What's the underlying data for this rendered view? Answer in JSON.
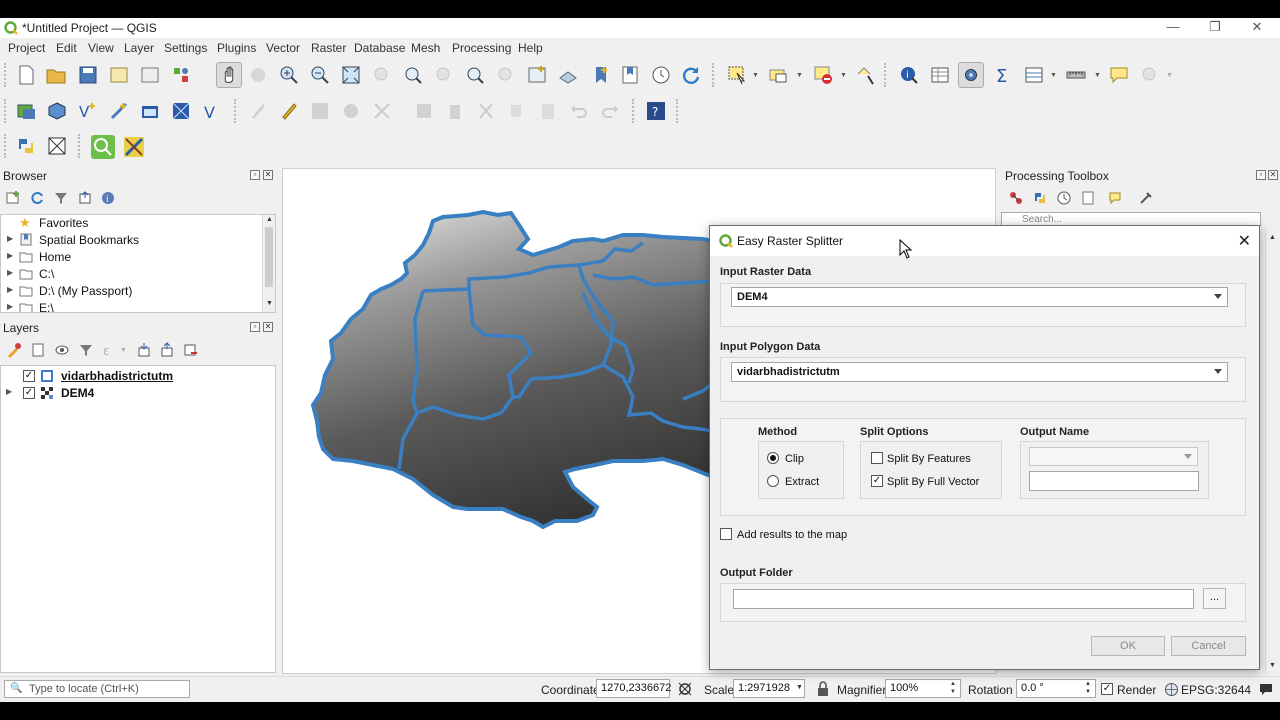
{
  "window": {
    "title": "*Untitled Project — QGIS",
    "controls": [
      "—",
      "❐",
      "✕"
    ]
  },
  "menubar": [
    "Project",
    "Edit",
    "View",
    "Layer",
    "Settings",
    "Plugins",
    "Vector",
    "Raster",
    "Database",
    "Mesh",
    "Processing",
    "Help"
  ],
  "browser": {
    "title": "Browser",
    "items": [
      {
        "label": "Favorites",
        "icon": "star-icon"
      },
      {
        "label": "Spatial Bookmarks",
        "icon": "bookmark-icon"
      },
      {
        "label": "Home",
        "icon": "folder-icon"
      },
      {
        "label": "C:\\",
        "icon": "folder-icon"
      },
      {
        "label": "D:\\ (My Passport)",
        "icon": "folder-icon"
      },
      {
        "label": "E:\\",
        "icon": "folder-icon"
      }
    ]
  },
  "layers": {
    "title": "Layers",
    "items": [
      {
        "label": "vidarbhadistrictutm",
        "checked": true
      },
      {
        "label": "DEM4",
        "checked": true
      }
    ]
  },
  "toolbox": {
    "title": "Processing Toolbox",
    "search_placeholder": "Search..."
  },
  "dialog": {
    "title": "Easy Raster Splitter",
    "input_raster_label": "Input Raster Data",
    "input_raster_value": "DEM4",
    "input_polygon_label": "Input Polygon Data",
    "input_polygon_value": "vidarbhadistrictutm",
    "method_label": "Method",
    "method_clip": "Clip",
    "method_extract": "Extract",
    "method_selected": "Clip",
    "split_options_label": "Split Options",
    "split_by_features": "Split By Features",
    "split_by_features_checked": false,
    "split_by_full_vector": "Split By Full Vector",
    "split_by_full_vector_checked": true,
    "output_name_label": "Output Name",
    "output_name_value": "",
    "add_results_label": "Add results to the map",
    "add_results_checked": false,
    "output_folder_label": "Output Folder",
    "output_folder_value": "",
    "browse_label": "...",
    "ok_label": "OK",
    "cancel_label": "Cancel"
  },
  "statusbar": {
    "locate_placeholder": "Type to locate (Ctrl+K)",
    "coordinate_label": "Coordinate",
    "coordinate_value": "1270,2336672",
    "scale_label": "Scale",
    "scale_value": "1:2971928",
    "magnifier_label": "Magnifier",
    "magnifier_value": "100%",
    "rotation_label": "Rotation",
    "rotation_value": "0.0 °",
    "render_label": "Render",
    "crs_label": "EPSG:32644"
  },
  "colors": {
    "district_outline": "#3a7fc2",
    "qgis_green": "#5fa83a",
    "chrome_bg": "#f0f0f0"
  }
}
